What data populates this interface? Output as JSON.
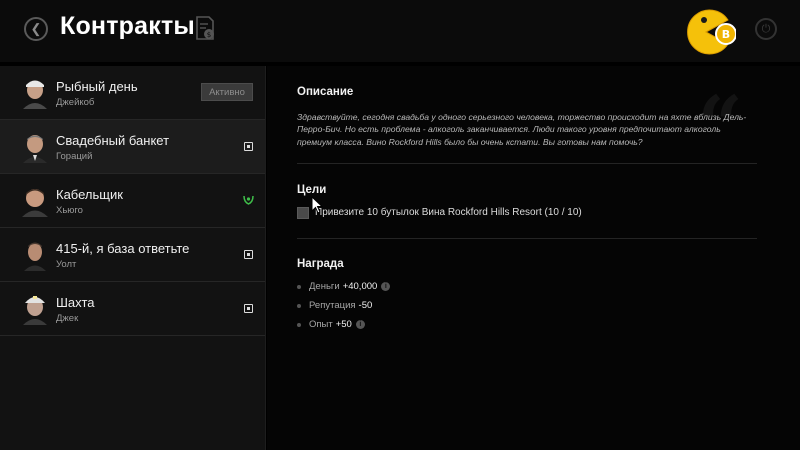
{
  "header": {
    "title": "Контракты",
    "back_icon": "back-arrow-icon",
    "doc_icon": "contract-document-icon",
    "logo": "pacman-coin-logo",
    "power_icon": "power-icon"
  },
  "contacts": [
    {
      "name": "Рыбный день",
      "giver": "Джейкоб",
      "status_label": "Активно",
      "icon": null,
      "selected": false
    },
    {
      "name": "Свадебный банкет",
      "giver": "Гораций",
      "status_label": null,
      "icon": "square-target-icon",
      "selected": true
    },
    {
      "name": "Кабельщик",
      "giver": "Хьюго",
      "status_label": null,
      "icon": "green-laurel-icon",
      "selected": false
    },
    {
      "name": "415-й, я база ответьте",
      "giver": "Уолт",
      "status_label": null,
      "icon": "square-target-icon",
      "selected": false
    },
    {
      "name": "Шахта",
      "giver": "Джек",
      "status_label": null,
      "icon": "square-target-icon",
      "selected": false
    }
  ],
  "details": {
    "description_title": "Описание",
    "description": "Здравствуйте, сегодня свадьба у одного серьезного человека, торжество происходит на яхте вблизь Дель-Перро-Бич. Но есть проблема - алкоголь заканчивается. Люди такого уровня предпочитают алкоголь премиум класса. Вино Rockford Hills было бы очень кстати. Вы готовы нам помочь?",
    "objectives_title": "Цели",
    "objectives": [
      {
        "text": "Привезите 10 бутылок Вина Rockford Hills Resort (10 / 10)"
      }
    ],
    "reward_title": "Награда",
    "rewards": [
      {
        "label": "Деньги",
        "value": "+40,000",
        "info": true
      },
      {
        "label": "Репутация",
        "value": "-50",
        "info": false
      },
      {
        "label": "Опыт",
        "value": "+50",
        "info": true
      }
    ]
  },
  "colors": {
    "background": "#000000",
    "sidebar": "#121212",
    "selected_row": "#1c1c1c",
    "accent_green": "#3fbf4a",
    "logo_yellow": "#f5c10a"
  }
}
